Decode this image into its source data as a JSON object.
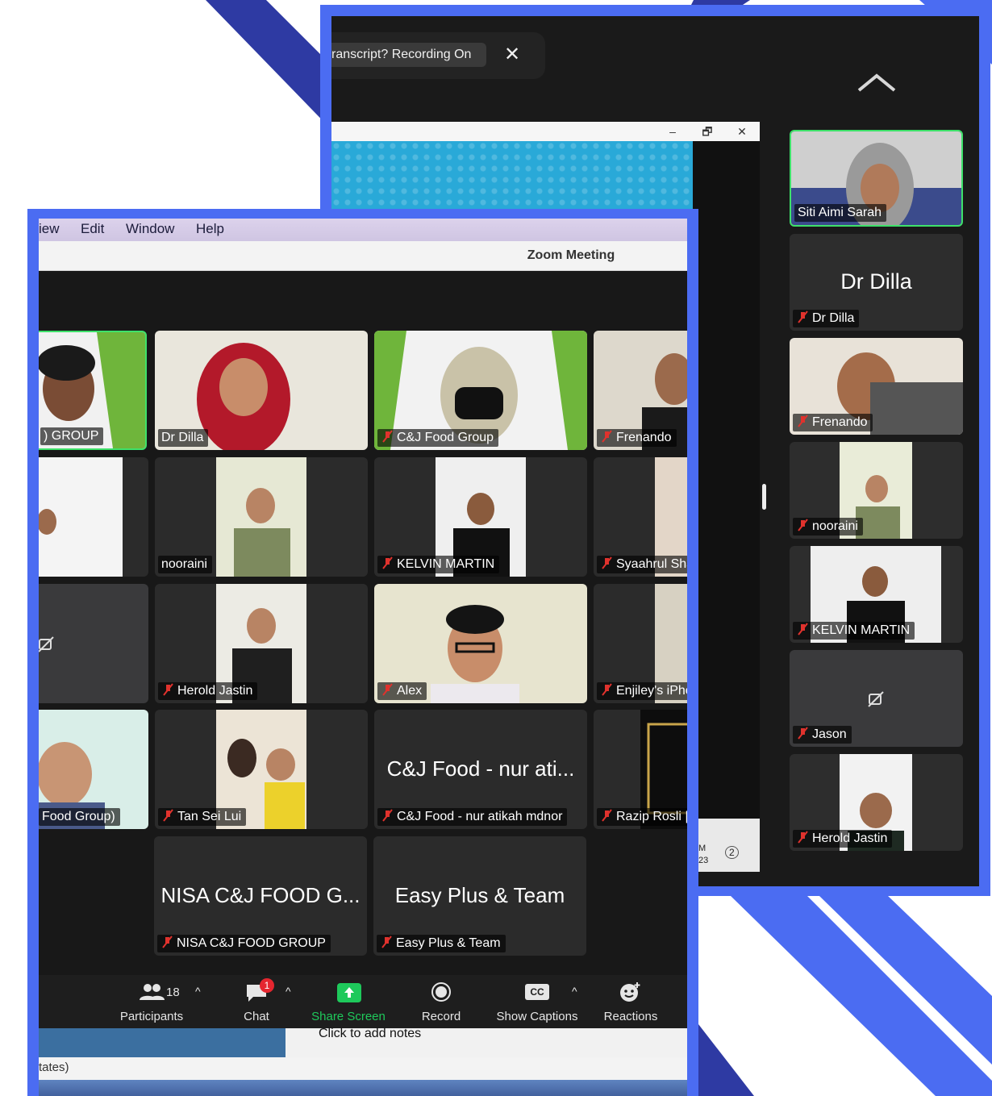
{
  "colors": {
    "frame_blue": "#4b6cf2",
    "deco_dark": "#2e3aa3",
    "active_speaker": "#3ee16a",
    "muted_red": "#e0322d",
    "share_green": "#1ec95b",
    "badge_red": "#e5262f"
  },
  "right_window": {
    "notification": "ranscript? Recording On",
    "close_icon": "✕",
    "chevron": "chevron-up-icon",
    "inner_window_buttons": [
      "–",
      "🗗",
      "✕"
    ],
    "inner_bottom_text": "M\n23",
    "inner_bottom_badge": "2",
    "tiles": [
      {
        "name": "Siti Aimi Sarah",
        "muted": false,
        "active": true,
        "big": ""
      },
      {
        "name": "Dr Dilla",
        "muted": true,
        "active": false,
        "big": "Dr Dilla"
      },
      {
        "name": "Frenando",
        "muted": true,
        "active": false,
        "big": ""
      },
      {
        "name": "nooraini",
        "muted": true,
        "active": false,
        "big": ""
      },
      {
        "name": "KELVIN MARTIN",
        "muted": true,
        "active": false,
        "big": ""
      },
      {
        "name": "Jason",
        "muted": true,
        "active": false,
        "big": ""
      },
      {
        "name": "Herold Jastin",
        "muted": true,
        "active": false,
        "big": ""
      }
    ]
  },
  "left_window": {
    "menu": [
      "iew",
      "Edit",
      "Window",
      "Help"
    ],
    "title": "Zoom Meeting",
    "tiles": [
      {
        "name": ") GROUP",
        "muted": false,
        "active": true,
        "big": ""
      },
      {
        "name": "Dr Dilla",
        "muted": false,
        "active": false,
        "big": ""
      },
      {
        "name": "C&J Food Group",
        "muted": true,
        "active": false,
        "big": ""
      },
      {
        "name": "Frenando",
        "muted": true,
        "active": false,
        "big": ""
      },
      {
        "name": "",
        "muted": false,
        "active": false,
        "big": ""
      },
      {
        "name": "nooraini",
        "muted": false,
        "active": false,
        "big": ""
      },
      {
        "name": "KELVIN MARTIN",
        "muted": true,
        "active": false,
        "big": ""
      },
      {
        "name": "Syaahrul Sha",
        "muted": true,
        "active": false,
        "big": ""
      },
      {
        "name": "",
        "muted": false,
        "active": false,
        "big": ""
      },
      {
        "name": "Herold Jastin",
        "muted": true,
        "active": false,
        "big": ""
      },
      {
        "name": "Alex",
        "muted": true,
        "active": false,
        "big": ""
      },
      {
        "name": "Enjiley's iPho",
        "muted": true,
        "active": false,
        "big": ""
      },
      {
        "name": "Food Group)",
        "muted": false,
        "active": false,
        "big": ""
      },
      {
        "name": "Tan Sei Lui",
        "muted": true,
        "active": false,
        "big": ""
      },
      {
        "name": "C&J Food - nur atikah mdnor",
        "muted": true,
        "active": false,
        "big": "C&J Food - nur ati..."
      },
      {
        "name": "Razip Rosli |",
        "muted": true,
        "active": false,
        "big": ""
      },
      {
        "name": "NISA C&J FOOD GROUP",
        "muted": true,
        "active": false,
        "big": "NISA C&J FOOD G..."
      },
      {
        "name": "Easy Plus & Team",
        "muted": true,
        "active": false,
        "big": "Easy Plus & Team"
      }
    ],
    "toolbar": {
      "participants_count": "18",
      "participants": "Participants",
      "chat": "Chat",
      "chat_badge": "1",
      "share": "Share Screen",
      "record": "Record",
      "captions": "Show Captions",
      "captions_icon": "CC",
      "reactions": "Reactions",
      "caret": "^"
    },
    "notes_placeholder": "Click to add notes",
    "status_text": "tates)"
  }
}
